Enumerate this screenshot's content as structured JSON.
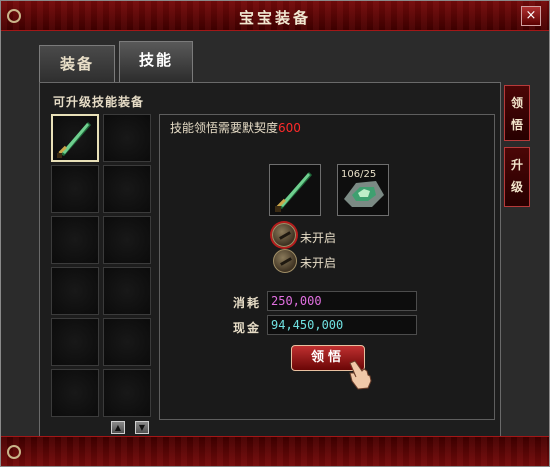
{
  "window": {
    "title": "宝宝装备",
    "close_label": "×"
  },
  "tabs": [
    {
      "label": "装备",
      "active": false
    },
    {
      "label": "技能",
      "active": true
    }
  ],
  "side_tabs": [
    {
      "label": "领\n悟"
    },
    {
      "label": "升\n级"
    }
  ],
  "section_label": "可升级技能装备",
  "slots": {
    "count": 12,
    "selected_index": 0,
    "filled": [
      "green-sword-icon"
    ]
  },
  "panel": {
    "requirement_text": "技能领悟需要默契度",
    "requirement_value": "600",
    "item_count": "106/25",
    "options": [
      {
        "label": "未开启",
        "selected": true
      },
      {
        "label": "未开启",
        "selected": false
      }
    ],
    "consume_label": "消耗",
    "consume_value": "250,000",
    "money_label": "现金",
    "money_value": "94,450,000",
    "learn_button": "领悟"
  },
  "colors": {
    "title_bar": "#6d0a0a",
    "requirement_value": "#ff2a2a",
    "consume_value": "#e070e0",
    "money_value": "#6fe0e0"
  }
}
